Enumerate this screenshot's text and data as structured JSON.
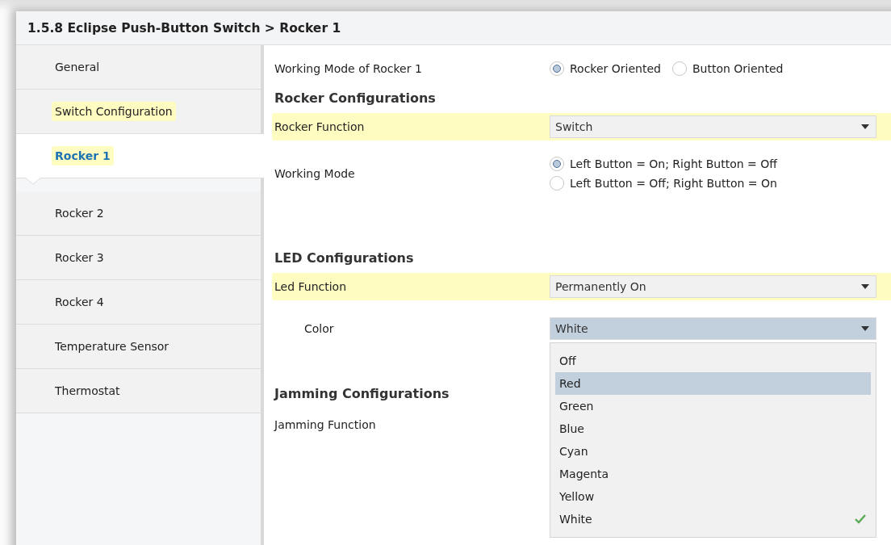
{
  "window": {
    "title": "1.5.8 Eclipse Push-Button Switch > Rocker 1"
  },
  "sidebar": {
    "items": [
      {
        "label": "General",
        "selected": false,
        "highlighted": false
      },
      {
        "label": "Switch Configuration",
        "selected": false,
        "highlighted": true
      },
      {
        "label": "Rocker 1",
        "selected": true,
        "highlighted": true
      },
      {
        "label": "Rocker 2",
        "selected": false,
        "highlighted": false
      },
      {
        "label": "Rocker 3",
        "selected": false,
        "highlighted": false
      },
      {
        "label": "Rocker 4",
        "selected": false,
        "highlighted": false
      },
      {
        "label": "Temperature Sensor",
        "selected": false,
        "highlighted": false
      },
      {
        "label": "Thermostat",
        "selected": false,
        "highlighted": false
      }
    ]
  },
  "rows": [
    {
      "kind": "radio-inline",
      "label": "Working Mode of Rocker 1",
      "options": [
        {
          "label": "Rocker Oriented",
          "selected": true
        },
        {
          "label": "Button Oriented",
          "selected": false
        }
      ]
    },
    {
      "kind": "heading",
      "label": "Rocker Configurations"
    },
    {
      "kind": "dropdown",
      "label": "Rocker Function",
      "value": "Switch",
      "highlighted": true,
      "indented": false
    },
    {
      "kind": "radio-stack",
      "label": "Working Mode",
      "options": [
        {
          "label": "Left Button = On; Right Button = Off",
          "selected": true
        },
        {
          "label": "Left Button = Off; Right Button = On",
          "selected": false
        }
      ]
    },
    {
      "kind": "heading",
      "label": "LED Configurations"
    },
    {
      "kind": "dropdown",
      "label": "Led Function",
      "value": "Permanently On",
      "highlighted": true,
      "indented": false
    },
    {
      "kind": "dropdown",
      "label": "Color",
      "value": "White",
      "highlighted": false,
      "indented": true,
      "expanded": true,
      "options": [
        {
          "label": "Off",
          "selected": false,
          "hovered": false
        },
        {
          "label": "Red",
          "selected": false,
          "hovered": true
        },
        {
          "label": "Green",
          "selected": false,
          "hovered": false
        },
        {
          "label": "Blue",
          "selected": false,
          "hovered": false
        },
        {
          "label": "Cyan",
          "selected": false,
          "hovered": false
        },
        {
          "label": "Magenta",
          "selected": false,
          "hovered": false
        },
        {
          "label": "Yellow",
          "selected": false,
          "hovered": false
        },
        {
          "label": "White",
          "selected": true,
          "hovered": false
        }
      ]
    },
    {
      "kind": "heading",
      "label": "Jamming Configurations"
    },
    {
      "kind": "label",
      "label": "Jamming Function"
    }
  ]
}
